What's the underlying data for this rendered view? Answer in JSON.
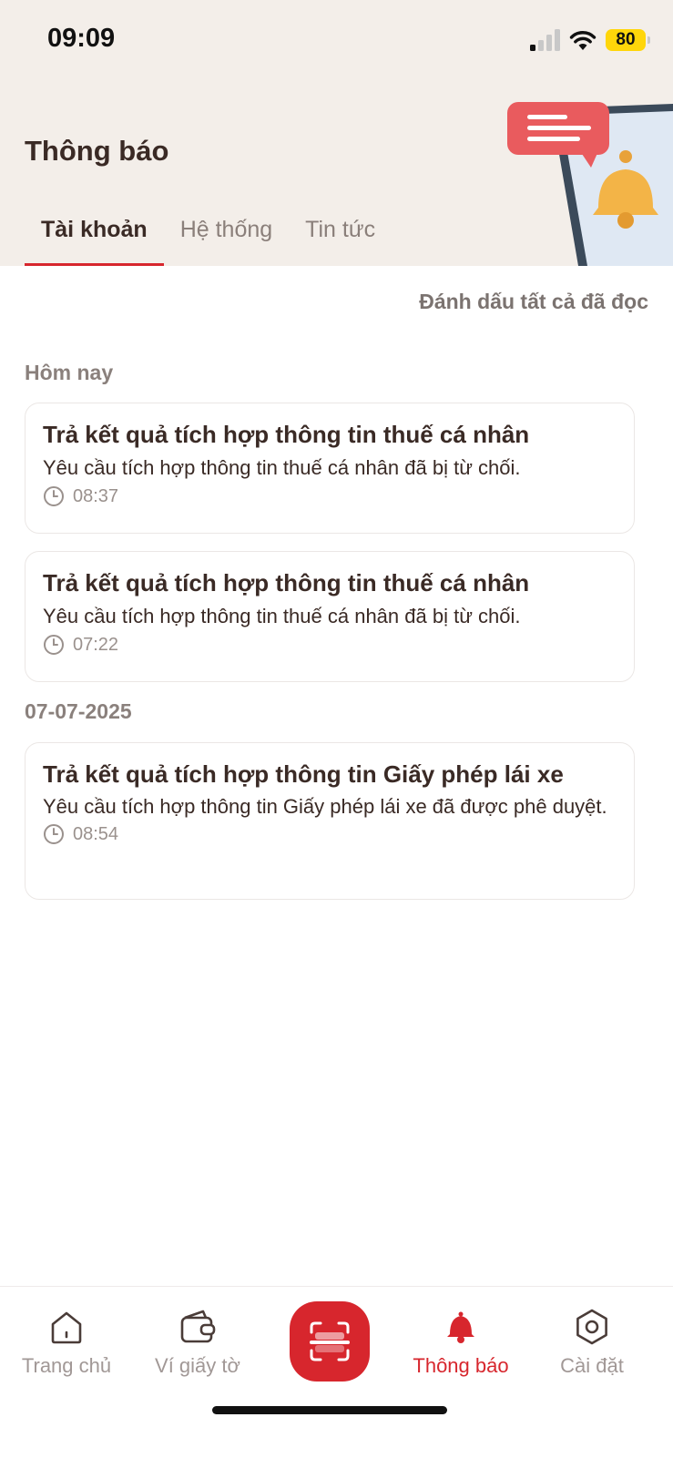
{
  "status_bar": {
    "time": "09:09",
    "battery": "80"
  },
  "header": {
    "title": "Thông báo",
    "tabs": [
      {
        "label": "Tài khoản",
        "active": true
      },
      {
        "label": "Hệ thống",
        "active": false
      },
      {
        "label": "Tin tức",
        "active": false
      }
    ]
  },
  "actions": {
    "mark_all_read": "Đánh dấu tất cả đã đọc"
  },
  "sections": [
    {
      "label": "Hôm nay",
      "items": [
        {
          "title": "Trả kết quả tích hợp thông tin thuế cá nhân",
          "body": "Yêu cầu tích hợp thông tin thuế cá nhân đã bị từ chối.",
          "time": "08:37"
        },
        {
          "title": "Trả kết quả tích hợp thông tin thuế cá nhân",
          "body": "Yêu cầu tích hợp thông tin thuế cá nhân đã bị từ chối.",
          "time": "07:22"
        }
      ]
    },
    {
      "label": "07-07-2025",
      "items": [
        {
          "title": "Trả kết quả tích hợp thông tin Giấy phép lái xe",
          "body": "Yêu cầu tích hợp thông tin Giấy phép lái xe đã được phê duyệt.",
          "time": "08:54"
        }
      ]
    }
  ],
  "bottom_nav": {
    "items": [
      {
        "label": "Trang chủ",
        "icon": "home-icon"
      },
      {
        "label": "Ví giấy tờ",
        "icon": "wallet-icon"
      },
      {
        "label": "",
        "icon": "scan-icon"
      },
      {
        "label": "Thông báo",
        "icon": "bell-icon",
        "active": true
      },
      {
        "label": "Cài đặt",
        "icon": "settings-icon"
      }
    ]
  },
  "colors": {
    "accent": "#d7262d",
    "header_bg": "#f3eee9",
    "text": "#3a2a25"
  }
}
